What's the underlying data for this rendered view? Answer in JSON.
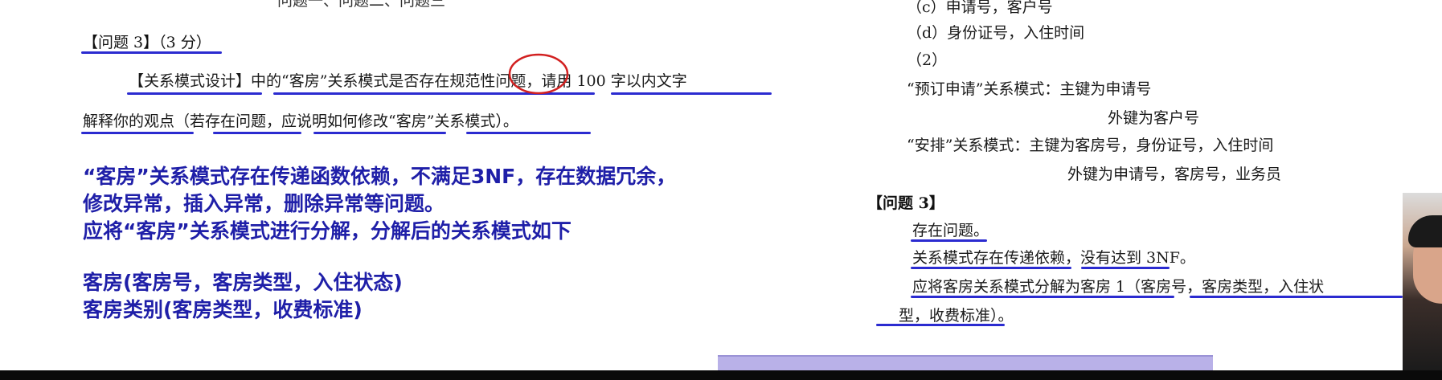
{
  "left": {
    "top_cut_text": "问题一、问题二、问题三",
    "question_label": "【问题 3】（3 分）",
    "prompt_line1": "【关系模式设计】中的“客房”关系模式是否存在规范性问题，请用 100 字以内文字",
    "prompt_line2": "解释你的观点（若存在问题，应说明如何修改“客房”关系模式）。",
    "answer": [
      "“客房”关系模式存在传递函数依赖，不满足3NF，存在数据冗余，",
      "修改异常，插入异常，删除异常等问题。",
      "应将“客房”关系模式进行分解，分解后的关系模式如下",
      "客房(客房号，客房类型，入住状态)",
      "客房类别(客房类型，收费标准)"
    ]
  },
  "right": {
    "line_c": "（c）申请号，客户号",
    "line_d": "（d）身份证号，入住时间",
    "line_2": "（2）",
    "booking_pk": "“预订申请”关系模式：主键为申请号",
    "booking_fk": "外键为客户号",
    "arrange_pk": "“安排”关系模式：主键为客房号，身份证号，入住时间",
    "arrange_fk": "外键为申请号，客房号，业务员",
    "q3_label": "【问题 3】",
    "q3_lines": [
      "存在问题。",
      "关系模式存在传递依赖，没有达到 3NF。",
      "应将客房关系模式分解为客房 1（客房号，客房类型，入住状",
      "型，收费标准）。"
    ]
  },
  "colors": {
    "answer_blue": "#1f1fa8",
    "annotation_blue": "#2b2bd0",
    "annotation_red": "#d22020",
    "bottom_bar": "#0a0a0a",
    "progress_bar": "#b9b1e8"
  }
}
